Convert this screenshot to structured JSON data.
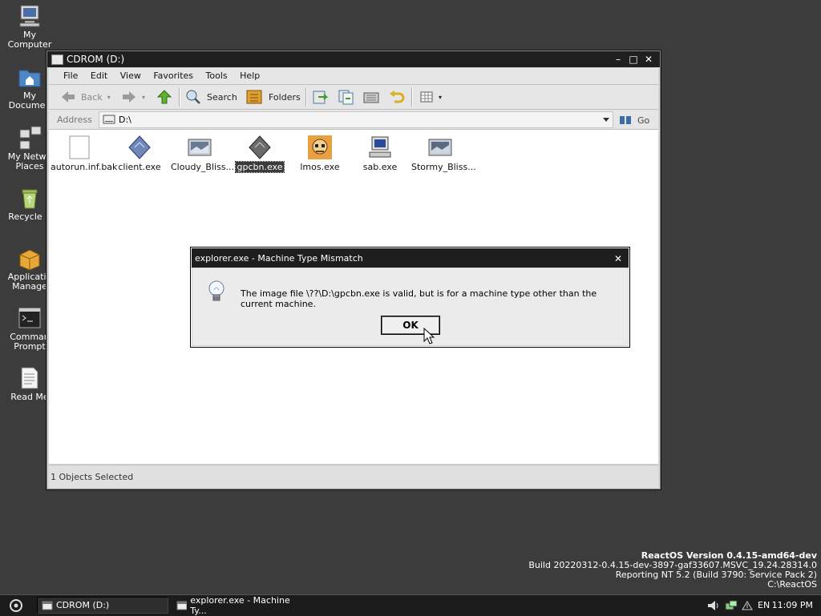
{
  "desktop": {
    "icons": [
      {
        "label": "My\nComputer"
      },
      {
        "label": "My\nDocumen"
      },
      {
        "label": "My Netwo\nPlaces"
      },
      {
        "label": "Recycle B"
      },
      {
        "label": "Applicatio\nManage"
      },
      {
        "label": "Comman\nPrompt"
      },
      {
        "label": "Read Me"
      }
    ]
  },
  "window": {
    "title": "CDROM (D:)",
    "controls": {
      "minimize": "–",
      "maximize": "□",
      "close": "✕"
    },
    "menu": [
      "File",
      "Edit",
      "View",
      "Favorites",
      "Tools",
      "Help"
    ],
    "toolbar": {
      "back": "Back",
      "search": "Search",
      "folders": "Folders"
    },
    "address": {
      "label": "Address",
      "value": "D:\\",
      "go": "Go"
    },
    "files": [
      {
        "name": "autorun.inf.bak",
        "icon": "blank-file-icon",
        "selected": false
      },
      {
        "name": "client.exe",
        "icon": "exe-diamond-icon",
        "selected": false
      },
      {
        "name": "Cloudy_Bliss...",
        "icon": "image-app-icon",
        "selected": false
      },
      {
        "name": "gpcbn.exe",
        "icon": "exe-diamond-icon",
        "selected": true
      },
      {
        "name": "lmos.exe",
        "icon": "character-app-icon",
        "selected": false
      },
      {
        "name": "sab.exe",
        "icon": "computer-app-icon",
        "selected": false
      },
      {
        "name": "Stormy_Bliss...",
        "icon": "image-app-icon",
        "selected": false
      }
    ],
    "status": "1 Objects Selected"
  },
  "dialog": {
    "title": "explorer.exe - Machine Type Mismatch",
    "close": "✕",
    "message": "The image file \\??\\D:\\gpcbn.exe is valid, but is for a machine type other than the current machine.",
    "ok": "OK"
  },
  "version": {
    "line1": "ReactOS Version 0.4.15-amd64-dev",
    "line2": "Build 20220312-0.4.15-dev-3897-gaf33607.MSVC_19.24.28314.0",
    "line3": "Reporting NT 5.2 (Build 3790: Service Pack 2)",
    "line4": "C:\\ReactOS"
  },
  "taskbar": {
    "tasks": [
      {
        "label": "CDROM (D:)",
        "active": true
      },
      {
        "label": "explorer.exe - Machine Ty...",
        "active": false
      }
    ],
    "tray": {
      "lang": "EN"
    },
    "clock": "11:09 PM"
  },
  "colors": {
    "desktop": "#3c3c3c",
    "titlebar": "#1f1f1f",
    "selection": "#3b3b3b"
  }
}
